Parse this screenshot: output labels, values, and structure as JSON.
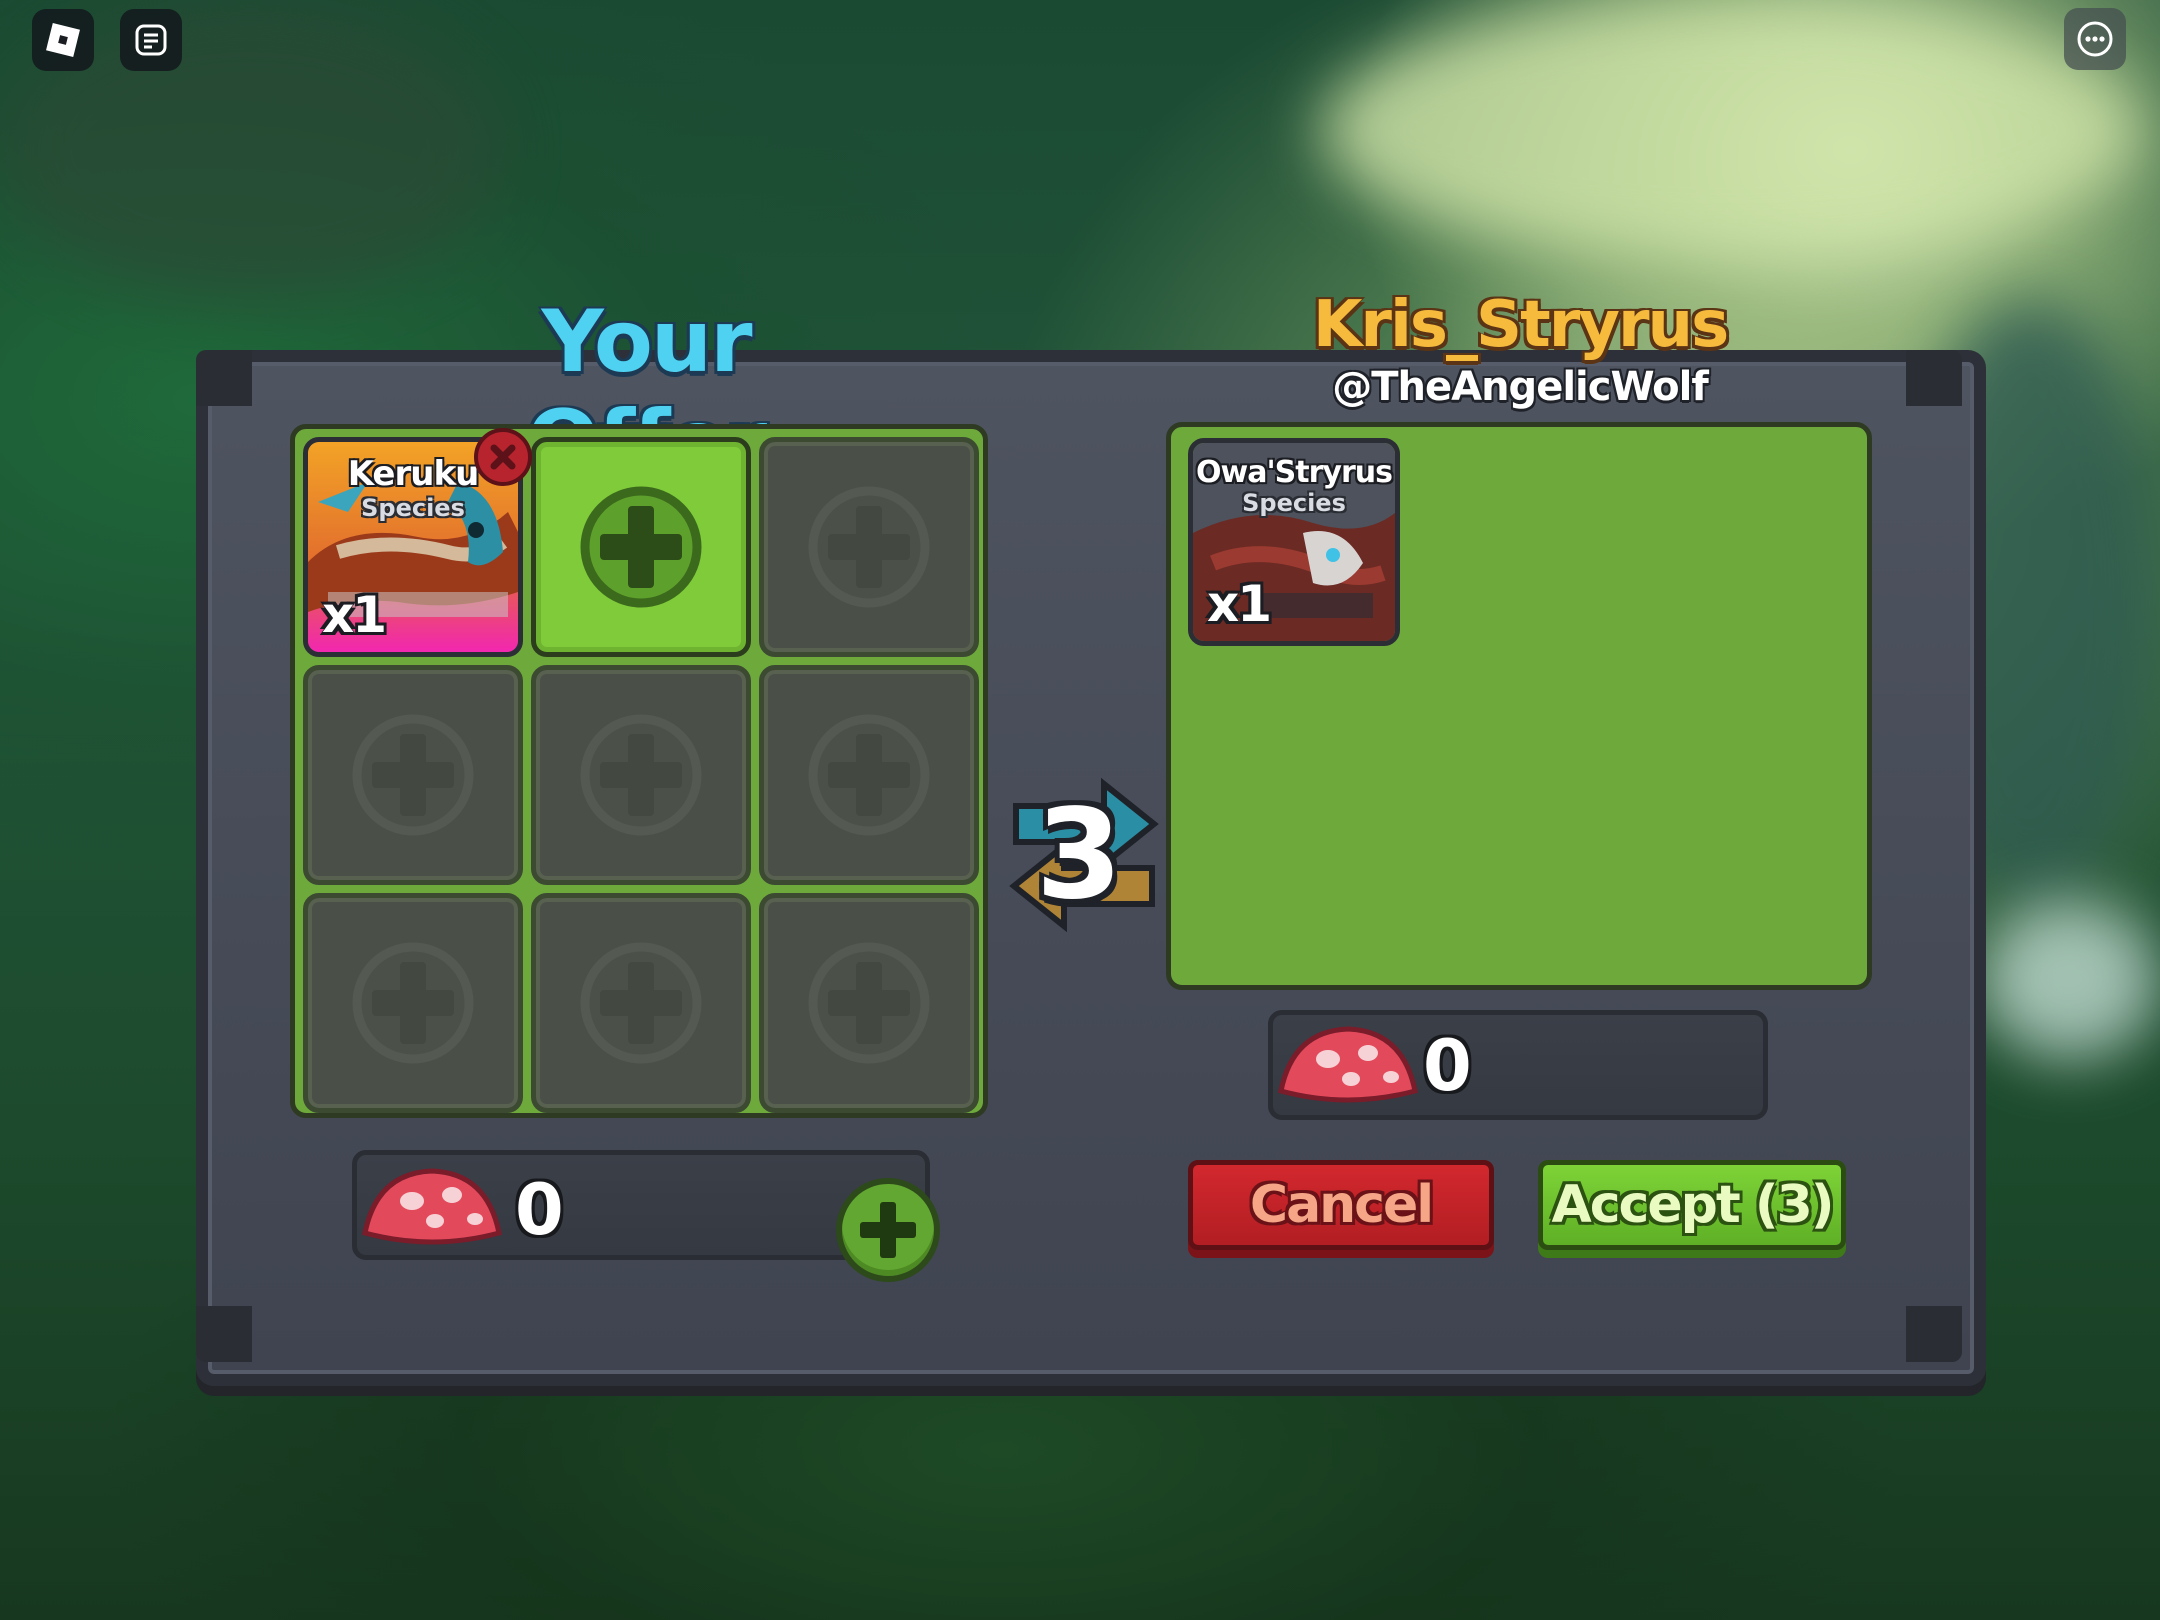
{
  "offer": {
    "title": "Your Offer",
    "items": [
      {
        "name": "Keruku",
        "type": "Species",
        "quantity": "x1"
      }
    ],
    "currency_amount": "0"
  },
  "partner": {
    "display_name": "Kris_Stryrus",
    "handle": "@TheAngelicWolf",
    "items": [
      {
        "name": "Owa'Stryrus",
        "type": "Species",
        "quantity": "x1"
      }
    ],
    "currency_amount": "0"
  },
  "ready_countdown": "3",
  "buttons": {
    "cancel": "Cancel",
    "accept": "Accept (3)"
  },
  "icons": {
    "top_left": [
      "roblox-logo-icon",
      "chat-icon"
    ],
    "top_right": "more-options-icon",
    "currency": "mushroom-icon"
  },
  "colors": {
    "offer_title": "#4fd2f2",
    "partner_title": "#f6ba3c",
    "grid_green": "#6ea93c",
    "cancel_red": "#c22328",
    "accept_green": "#6fc22e"
  }
}
